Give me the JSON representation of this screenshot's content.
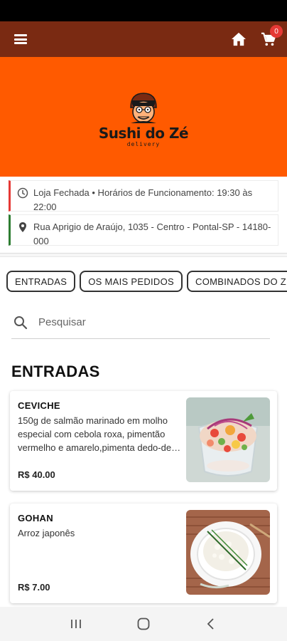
{
  "header": {
    "menu_icon": "hamburger-menu-icon",
    "home_icon": "home-icon",
    "cart_icon": "cart-icon",
    "cart_count": "0",
    "background": "#7a2a12"
  },
  "banner": {
    "background": "#ff5a00",
    "logo_name": "Sushi do Zé",
    "logo_sub": "delivery"
  },
  "store_info": {
    "hours_icon": "clock-icon",
    "hours_text": "Loja Fechada • Horários de Funcionamento: 19:30 às 22:00",
    "address_icon": "map-pin-icon",
    "address_text": "Rua Aprigio de Araújo, 1035 - Centro - Pontal-SP - 14180-000"
  },
  "category_tabs": [
    {
      "label": "ENTRADAS"
    },
    {
      "label": "OS MAIS PEDIDOS"
    },
    {
      "label": "COMBINADOS DO ZÉ"
    }
  ],
  "search": {
    "icon": "search-icon",
    "placeholder": "Pesquisar",
    "value": ""
  },
  "section": {
    "title": "ENTRADAS"
  },
  "products": [
    {
      "name": "CEVICHE",
      "description": "150g de salmão marinado em molho especial com cebola roxa, pimentão vermelho e amarelo,pimenta dedo-de-moça",
      "price": "R$ 40.00"
    },
    {
      "name": "GOHAN",
      "description": "Arroz japonês",
      "price": "R$ 7.00"
    }
  ],
  "system_nav": {
    "recents_icon": "recent-apps-icon",
    "home_icon": "home-circle-icon",
    "back_icon": "back-chevron-icon"
  }
}
